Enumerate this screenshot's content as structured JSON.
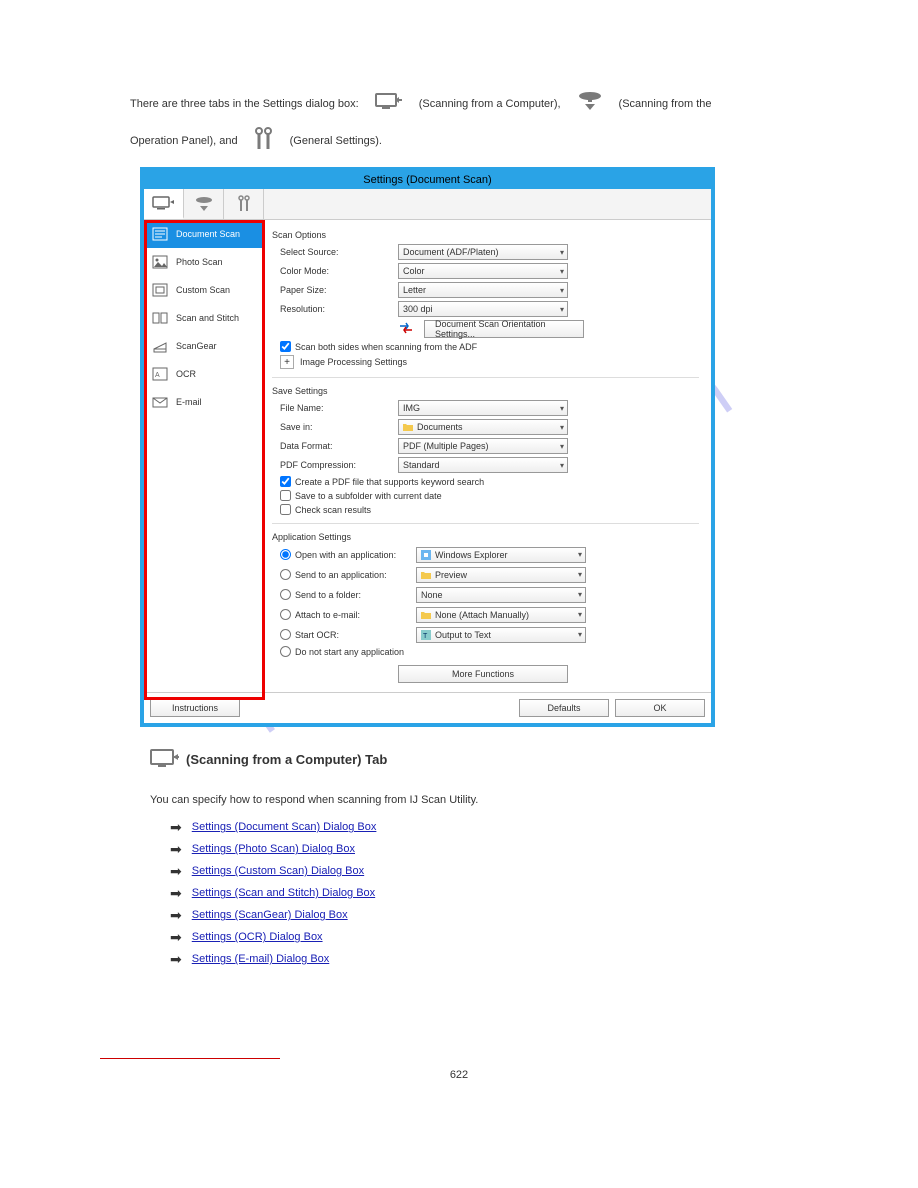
{
  "intro": {
    "line1_a": "There are three tabs in the Settings dialog box:",
    "line1_b": "(Scanning from a Computer),",
    "line1_c": "(Scanning from the",
    "line2_a": "Operation Panel), and",
    "line2_b": "(General Settings)."
  },
  "dialog": {
    "title": "Settings (Document Scan)",
    "sidebar": [
      {
        "label": "Document Scan"
      },
      {
        "label": "Photo Scan"
      },
      {
        "label": "Custom Scan"
      },
      {
        "label": "Scan and Stitch"
      },
      {
        "label": "ScanGear"
      },
      {
        "label": "OCR"
      },
      {
        "label": "E-mail"
      }
    ],
    "scan_options": {
      "heading": "Scan Options",
      "source_lbl": "Select Source:",
      "source_val": "Document (ADF/Platen)",
      "color_lbl": "Color Mode:",
      "color_val": "Color",
      "paper_lbl": "Paper Size:",
      "paper_val": "Letter",
      "res_lbl": "Resolution:",
      "res_val": "300 dpi",
      "orient_btn": "Document Scan Orientation Settings...",
      "scan_both": "Scan both sides when scanning from the ADF",
      "img_proc": "Image Processing Settings"
    },
    "save_settings": {
      "heading": "Save Settings",
      "file_lbl": "File Name:",
      "file_val": "IMG",
      "savein_lbl": "Save in:",
      "savein_val": "Documents",
      "format_lbl": "Data Format:",
      "format_val": "PDF (Multiple Pages)",
      "pdfcomp_lbl": "PDF Compression:",
      "pdfcomp_val": "Standard",
      "chk1": "Create a PDF file that supports keyword search",
      "chk2": "Save to a subfolder with current date",
      "chk3": "Check scan results"
    },
    "app_settings": {
      "heading": "Application Settings",
      "open_lbl": "Open with an application:",
      "open_val": "Windows Explorer",
      "send_lbl": "Send to an application:",
      "send_val": "Preview",
      "folder_lbl": "Send to a folder:",
      "folder_val": "None",
      "mail_lbl": "Attach to e-mail:",
      "mail_val": "None (Attach Manually)",
      "ocr_lbl": "Start OCR:",
      "ocr_val": "Output to Text",
      "none_lbl": "Do not start any application",
      "more_btn": "More Functions"
    },
    "footer": {
      "instructions": "Instructions",
      "defaults": "Defaults",
      "ok": "OK"
    }
  },
  "post": {
    "tab_heading": " (Scanning from a Computer) Tab",
    "desc": "You can specify how to respond when scanning from IJ Scan Utility.",
    "links": [
      "Settings (Document Scan) Dialog Box",
      "Settings (Photo Scan) Dialog Box",
      "Settings (Custom Scan) Dialog Box",
      "Settings (Scan and Stitch) Dialog Box",
      "Settings (ScanGear) Dialog Box",
      "Settings (OCR) Dialog Box",
      "Settings (E-mail) Dialog Box"
    ]
  },
  "watermark": "manualshive.com",
  "pagenum": "622"
}
